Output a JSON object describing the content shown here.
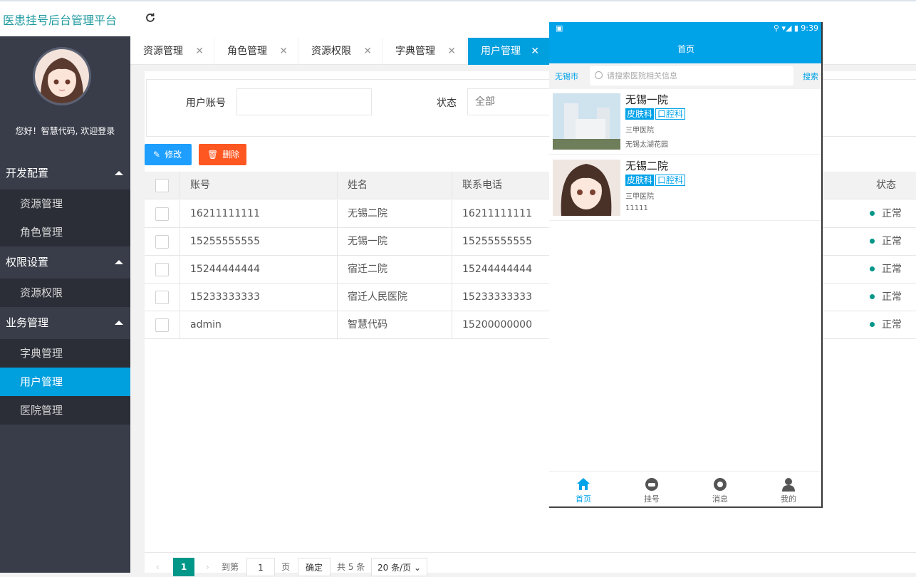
{
  "app": {
    "title": "医患挂号后台管理平台"
  },
  "sidebar": {
    "welcome": "您好！智慧代码, 欢迎登录",
    "groups": [
      {
        "label": "开发配置",
        "items": [
          "资源管理",
          "角色管理"
        ]
      },
      {
        "label": "权限设置",
        "items": [
          "资源权限"
        ]
      },
      {
        "label": "业务管理",
        "items": [
          "字典管理",
          "用户管理",
          "医院管理"
        ]
      }
    ],
    "active_item": "用户管理"
  },
  "tabs": [
    "资源管理",
    "角色管理",
    "资源权限",
    "字典管理",
    "用户管理"
  ],
  "tab_close": "✕",
  "filter": {
    "account_label": "用户账号",
    "account_value": "",
    "status_label": "状态",
    "status_value": "全部"
  },
  "toolbar": {
    "edit_label": "修改",
    "delete_label": "删除"
  },
  "table": {
    "columns": [
      "账号",
      "姓名",
      "联系电话",
      "状态"
    ],
    "rows": [
      {
        "account": "16211111111",
        "name": "无锡二院",
        "phone": "16211111111",
        "status": "正常"
      },
      {
        "account": "15255555555",
        "name": "无锡一院",
        "phone": "15255555555",
        "status": "正常"
      },
      {
        "account": "15244444444",
        "name": "宿迁二院",
        "phone": "15244444444",
        "status": "正常"
      },
      {
        "account": "15233333333",
        "name": "宿迁人民医院",
        "phone": "15233333333",
        "status": "正常"
      },
      {
        "account": "admin",
        "name": "智慧代码",
        "phone": "15200000000",
        "status": "正常"
      }
    ]
  },
  "pager": {
    "current": "1",
    "goto_label": "到第",
    "goto_value": "1",
    "page_unit": "页",
    "confirm": "确定",
    "total": "共 5 条",
    "page_size": "20 条/页"
  },
  "phone": {
    "time": "9:39",
    "header_title": "首页",
    "city": "无锡市",
    "search_placeholder": "请搜索医院相关信息",
    "search_button": "搜索",
    "hospitals": [
      {
        "name": "无锡一院",
        "tags": [
          "皮肤科",
          "口腔科"
        ],
        "level": "三甲医院",
        "address": "无锡太湖花园"
      },
      {
        "name": "无锡二院",
        "tags": [
          "皮肤科",
          "口腔科"
        ],
        "level": "三甲医院",
        "address": "11111"
      }
    ],
    "tabbar": [
      "首页",
      "挂号",
      "消息",
      "我的"
    ]
  },
  "colors": {
    "accent": "#009fde",
    "sidebar": "#393d49",
    "danger": "#ff5722",
    "primary": "#1e9fff",
    "status_dot": "#009688"
  }
}
